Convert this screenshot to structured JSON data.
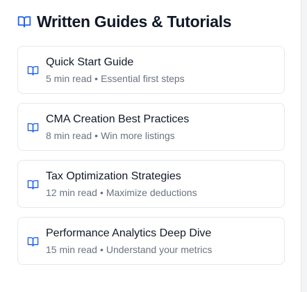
{
  "section": {
    "title": "Written Guides & Tutorials",
    "icon": "open-book-icon",
    "accent_color": "#2563eb"
  },
  "guides": [
    {
      "title": "Quick Start Guide",
      "read_time": "5 min read",
      "separator": "•",
      "description": "Essential first steps",
      "icon": "open-book-icon"
    },
    {
      "title": "CMA Creation Best Practices",
      "read_time": "8 min read",
      "separator": "•",
      "description": "Win more listings",
      "icon": "open-book-icon"
    },
    {
      "title": "Tax Optimization Strategies",
      "read_time": "12 min read",
      "separator": "•",
      "description": "Maximize deductions",
      "icon": "open-book-icon"
    },
    {
      "title": "Performance Analytics Deep Dive",
      "read_time": "15 min read",
      "separator": "•",
      "description": "Understand your metrics",
      "icon": "open-book-icon"
    }
  ]
}
